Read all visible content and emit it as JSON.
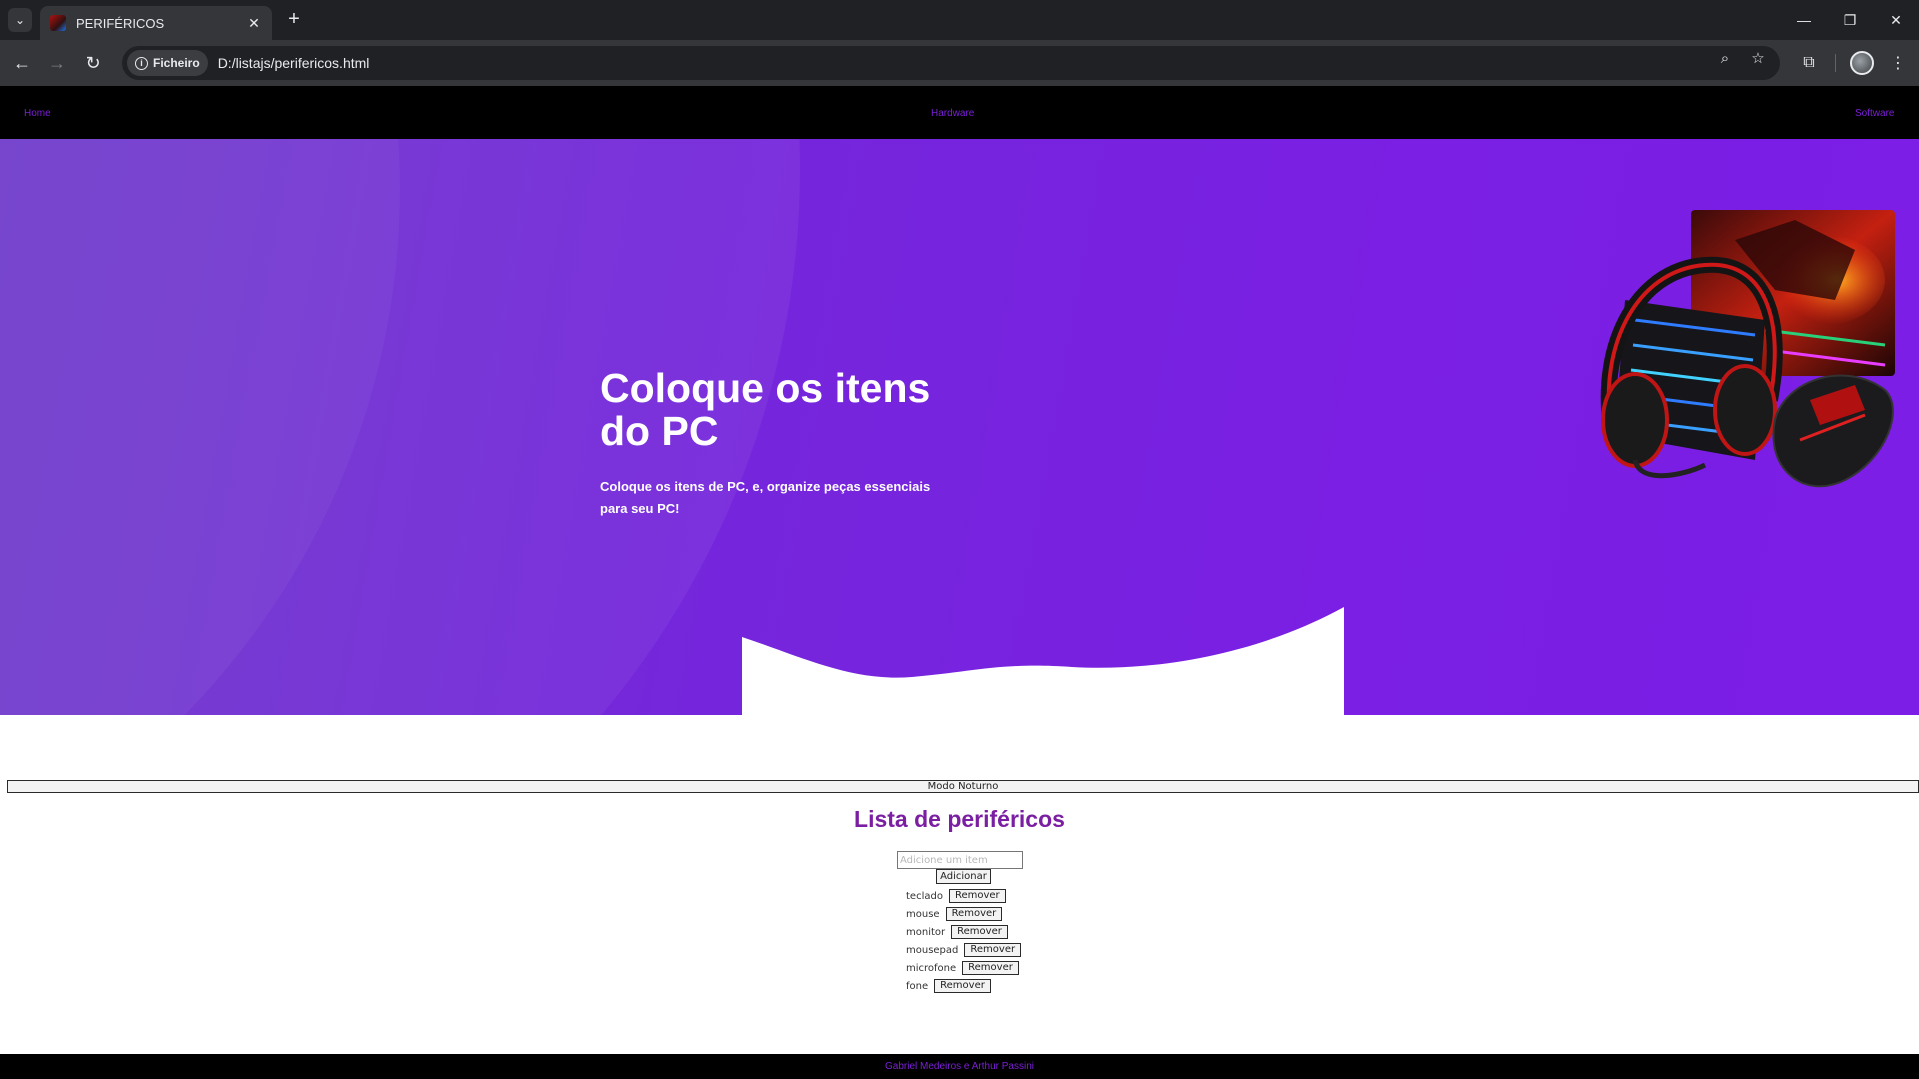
{
  "browser": {
    "tab_title": "PERIFÉRICOS",
    "chip_label": "Ficheiro",
    "url": "D:/listajs/perifericos.html"
  },
  "nav": {
    "home": "Home",
    "hardware": "Hardware",
    "software": "Software"
  },
  "hero": {
    "title": "Coloque os itens do PC",
    "subtitle": "Coloque os itens de PC, e, organize peças essenciais para seu PC!"
  },
  "night_mode_label": "Modo Noturno",
  "list": {
    "title": "Lista de periféricos",
    "input_placeholder": "Adicione um item",
    "add_label": "Adicionar",
    "remove_label": "Remover",
    "items": [
      "teclado",
      "mouse",
      "monitor",
      "mousepad",
      "microfone",
      "fone"
    ]
  },
  "footer": "Gabriel Medeiros e Arthur Passini",
  "colors": {
    "accent": "#7b1fd6",
    "hero_purple": "#7a1fe3",
    "nav_bg": "#000000"
  }
}
